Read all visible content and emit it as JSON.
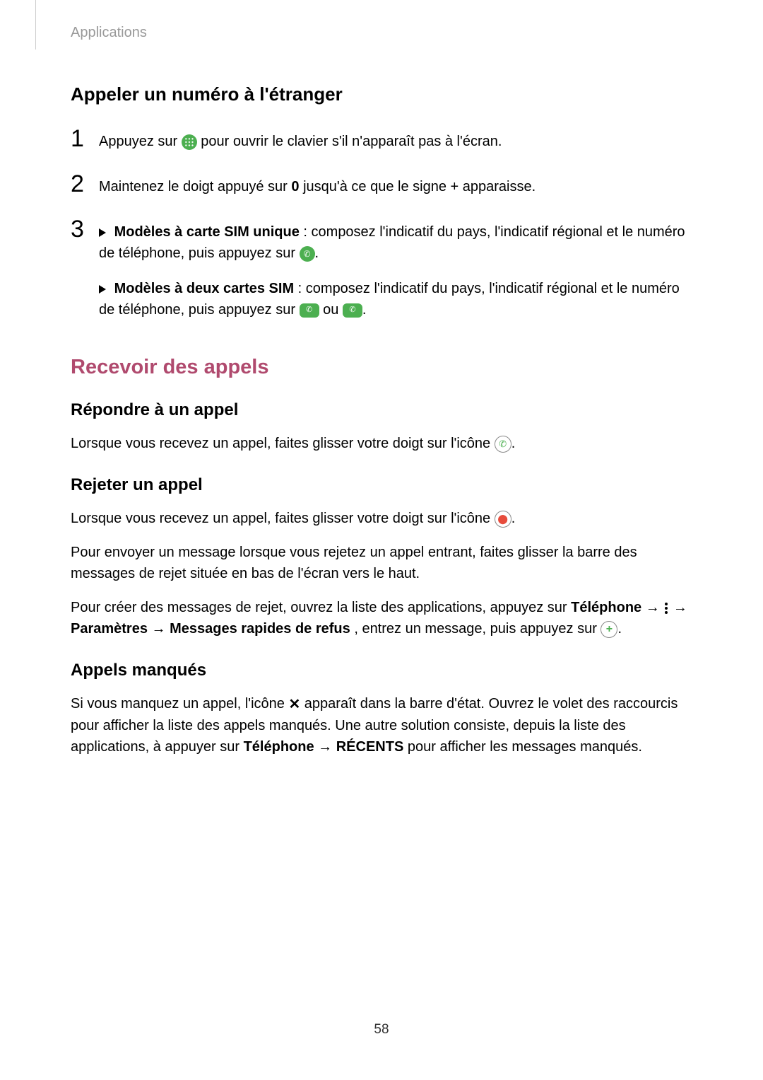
{
  "header": {
    "label": "Applications"
  },
  "sec_call_abroad": {
    "title": "Appeler un numéro à l'étranger",
    "step1": {
      "num": "1",
      "text_a": "Appuyez sur ",
      "text_b": " pour ouvrir le clavier s'il n'apparaît pas à l'écran."
    },
    "step2": {
      "num": "2",
      "text_a": "Maintenez le doigt appuyé sur ",
      "zero": "0",
      "text_b": " jusqu'à ce que le signe + apparaisse."
    },
    "step3": {
      "num": "3",
      "bold_a": "Modèles à carte SIM unique",
      "text_a": " : composez l'indicatif du pays, l'indicatif régional et le numéro de téléphone, puis appuyez sur ",
      "period_a": ".",
      "bold_b": "Modèles à deux cartes SIM",
      "text_b": " : composez l'indicatif du pays, l'indicatif régional et le numéro de téléphone, puis appuyez sur ",
      "ou": " ou ",
      "period_b": "."
    }
  },
  "sec_receive": {
    "title": "Recevoir des appels",
    "answer": {
      "title": "Répondre à un appel",
      "text": "Lorsque vous recevez un appel, faites glisser votre doigt sur l'icône ",
      "period": "."
    },
    "reject": {
      "title": "Rejeter un appel",
      "p1_a": "Lorsque vous recevez un appel, faites glisser votre doigt sur l'icône ",
      "p1_b": ".",
      "p2": "Pour envoyer un message lorsque vous rejetez un appel entrant, faites glisser la barre des messages de rejet située en bas de l'écran vers le haut.",
      "p3_a": "Pour créer des messages de rejet, ouvrez la liste des applications, appuyez sur ",
      "p3_bold1": "Téléphone",
      "p3_arrow1": " → ",
      "p3_arrow2": " → ",
      "p3_bold2": "Paramètres",
      "p3_arrow3": " → ",
      "p3_bold3": "Messages rapides de refus",
      "p3_b": ", entrez un message, puis appuyez sur ",
      "p3_c": "."
    },
    "missed": {
      "title": "Appels manqués",
      "p_a": "Si vous manquez un appel, l'icône ",
      "p_b": " apparaît dans la barre d'état. Ouvrez le volet des raccourcis pour afficher la liste des appels manqués. Une autre solution consiste, depuis la liste des applications, à appuyer sur ",
      "bold1": "Téléphone",
      "arrow": " → ",
      "bold2": "RÉCENTS",
      "p_c": " pour afficher les messages manqués."
    }
  },
  "page_number": "58"
}
